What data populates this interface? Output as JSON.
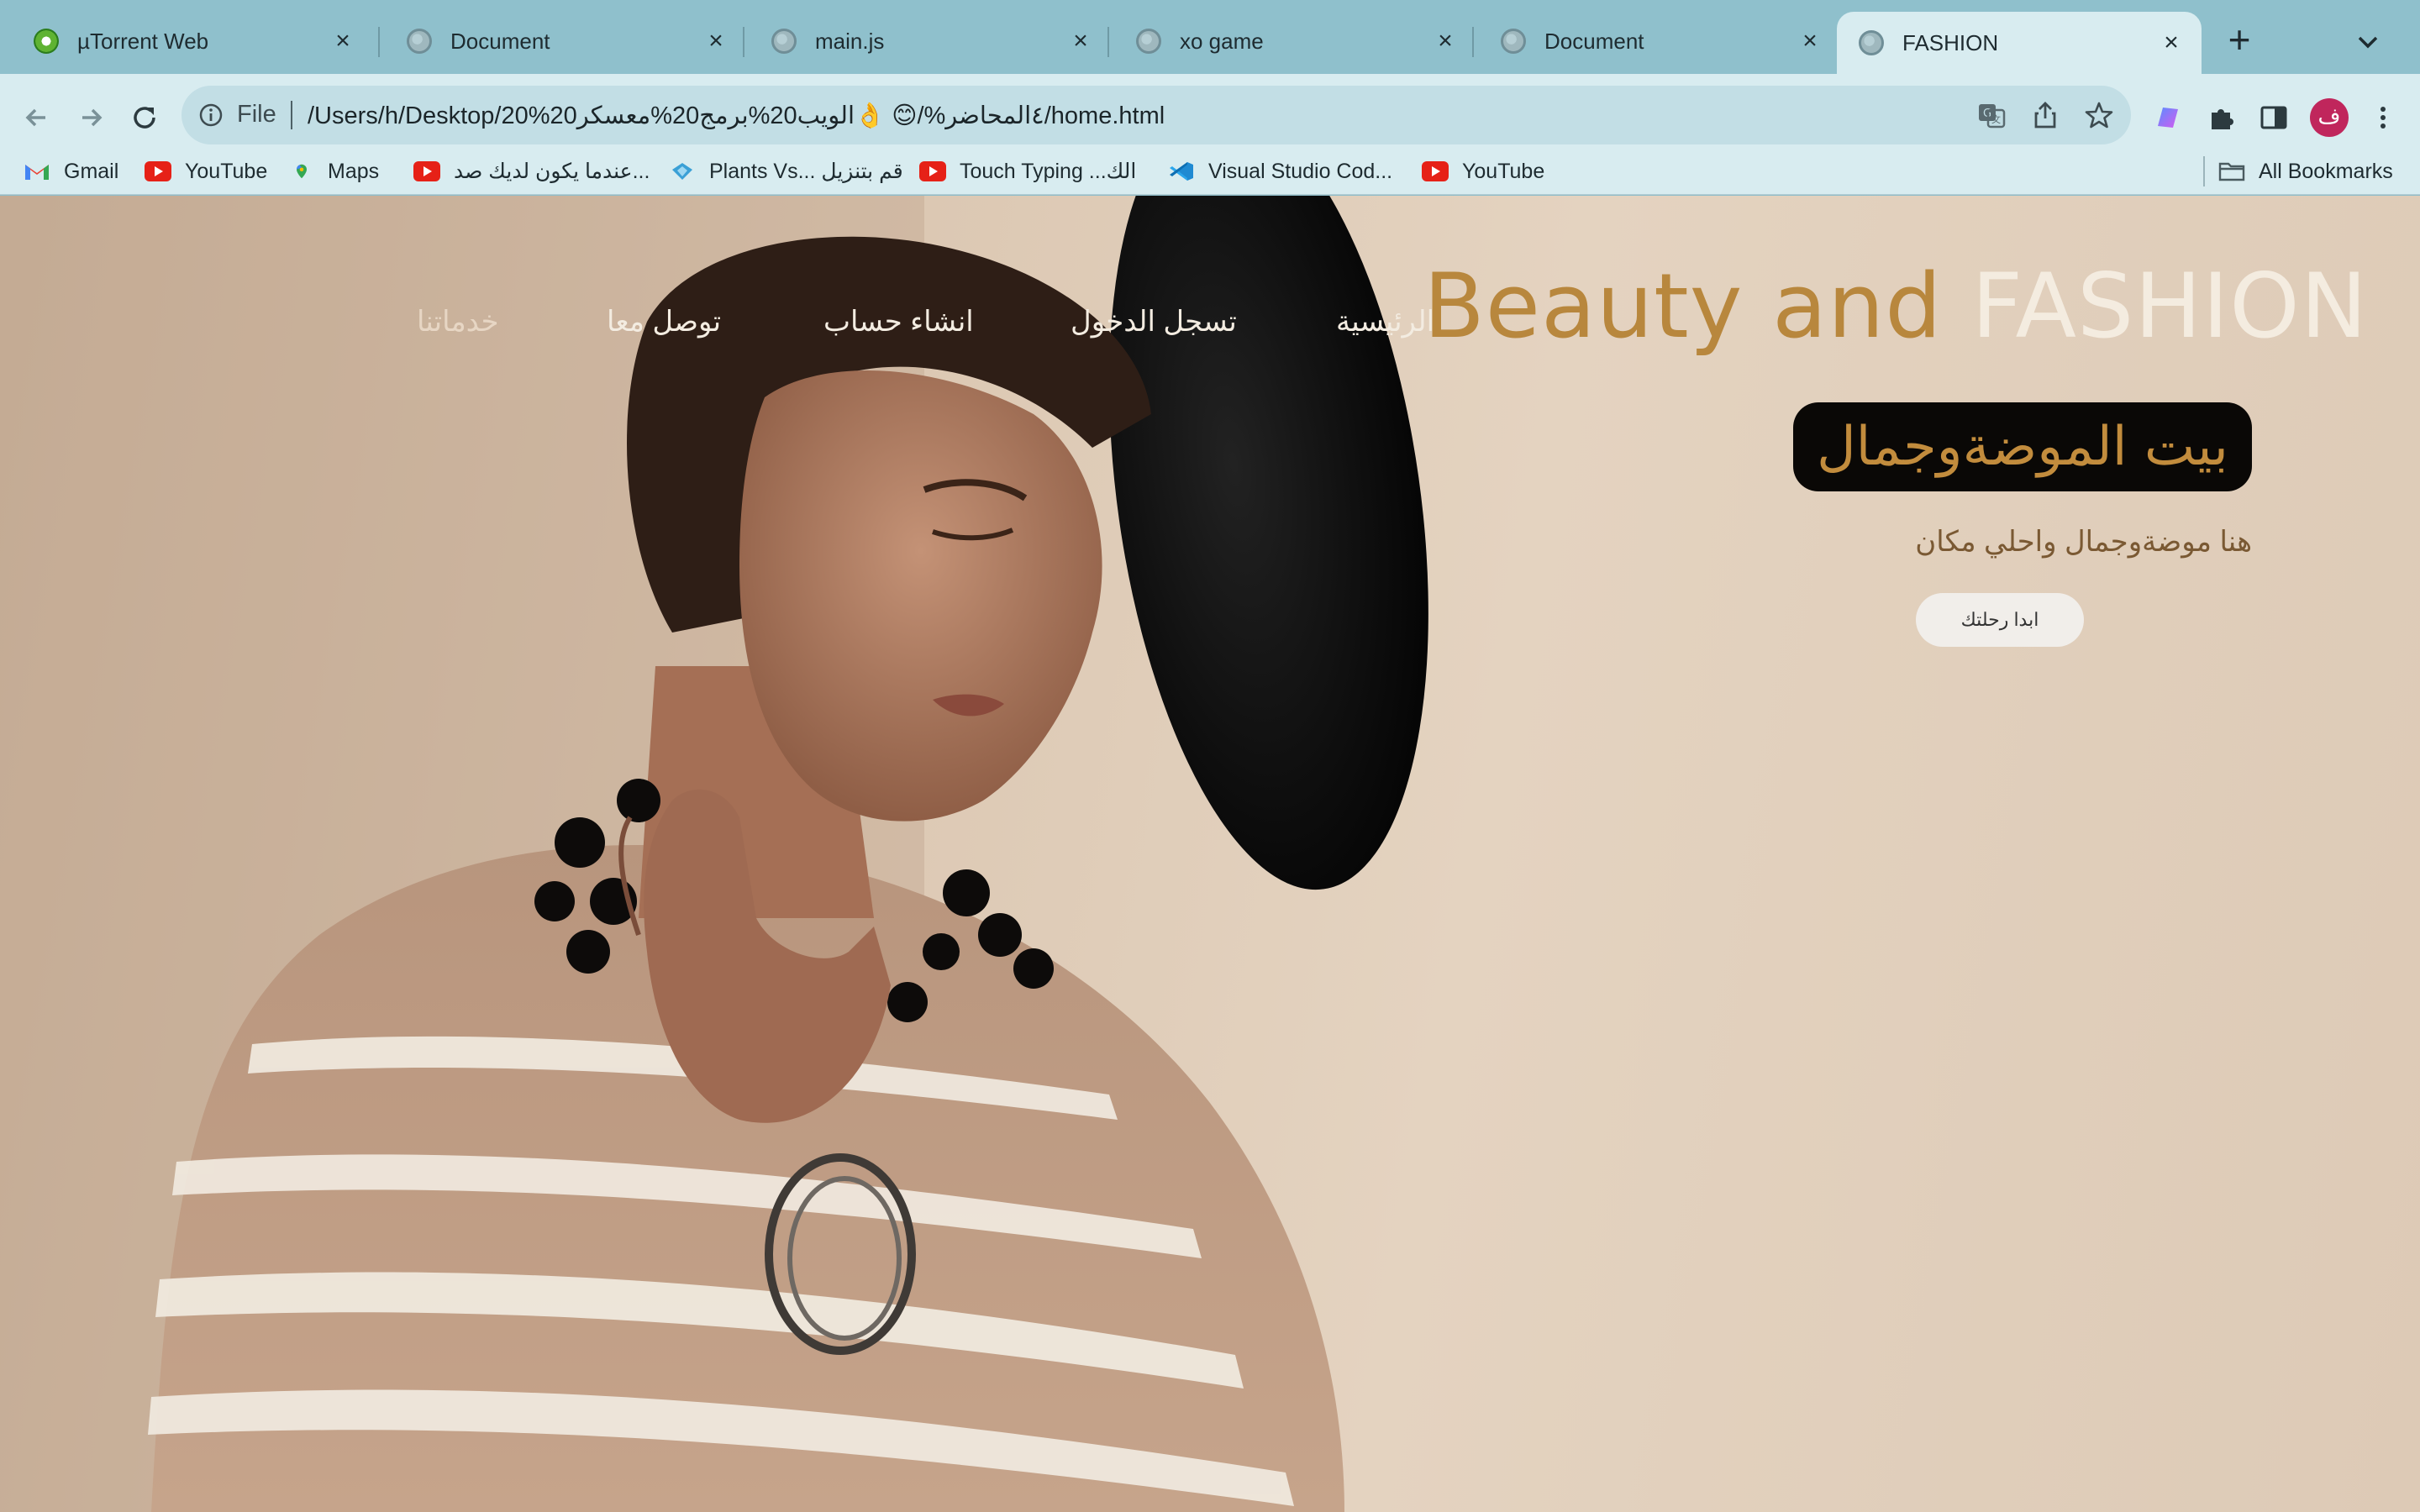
{
  "browser": {
    "tabs": [
      {
        "title": "µTorrent Web",
        "icon": "utorrent-icon"
      },
      {
        "title": "Document",
        "icon": "globe-icon"
      },
      {
        "title": "main.js",
        "icon": "globe-icon"
      },
      {
        "title": "xo game",
        "icon": "globe-icon"
      },
      {
        "title": "Document",
        "icon": "globe-icon"
      },
      {
        "title": "FASHION",
        "icon": "globe-icon",
        "active": true
      }
    ],
    "address": {
      "scheme": "File",
      "url": "/Users/h/Desktop/20%20٤المحاضر%/😊 👌الويب20%برمج20%معسكر/home.html"
    },
    "profile_initial": "ف",
    "bookmarks": [
      {
        "label": "Gmail",
        "icon": "gmail-icon"
      },
      {
        "label": "YouTube",
        "icon": "youtube-icon"
      },
      {
        "label": "Maps",
        "icon": "maps-icon"
      },
      {
        "label": "عندما يكون لديك صد...",
        "icon": "youtube-icon"
      },
      {
        "label": "Plants Vs... قم بتنزيل",
        "icon": "plants-icon"
      },
      {
        "label": "Touch Typing ...الك",
        "icon": "youtube-icon"
      },
      {
        "label": "Visual Studio Cod...",
        "icon": "vscode-icon"
      },
      {
        "label": "YouTube",
        "icon": "youtube-icon"
      }
    ],
    "all_bookmarks": "All Bookmarks"
  },
  "site": {
    "title_part1": "Beauty and",
    "title_part2": "FASHION",
    "nav": [
      "الرئيسية",
      "تسجل الدخول",
      "انشاء حساب",
      "توصل معا",
      "خدماتنا"
    ],
    "hero_heading": "بيت الموضةوجمال",
    "hero_subtitle": "هنا موضةوجمال واحلي مكان",
    "cta": "ابدا رحلتك"
  },
  "colors": {
    "accent_gold": "#b8873d",
    "title_light": "#f4ece0",
    "badge_bg": "#0a0806",
    "tab_strip": "#8fc0cc",
    "toolbar": "#d8ecf0"
  }
}
